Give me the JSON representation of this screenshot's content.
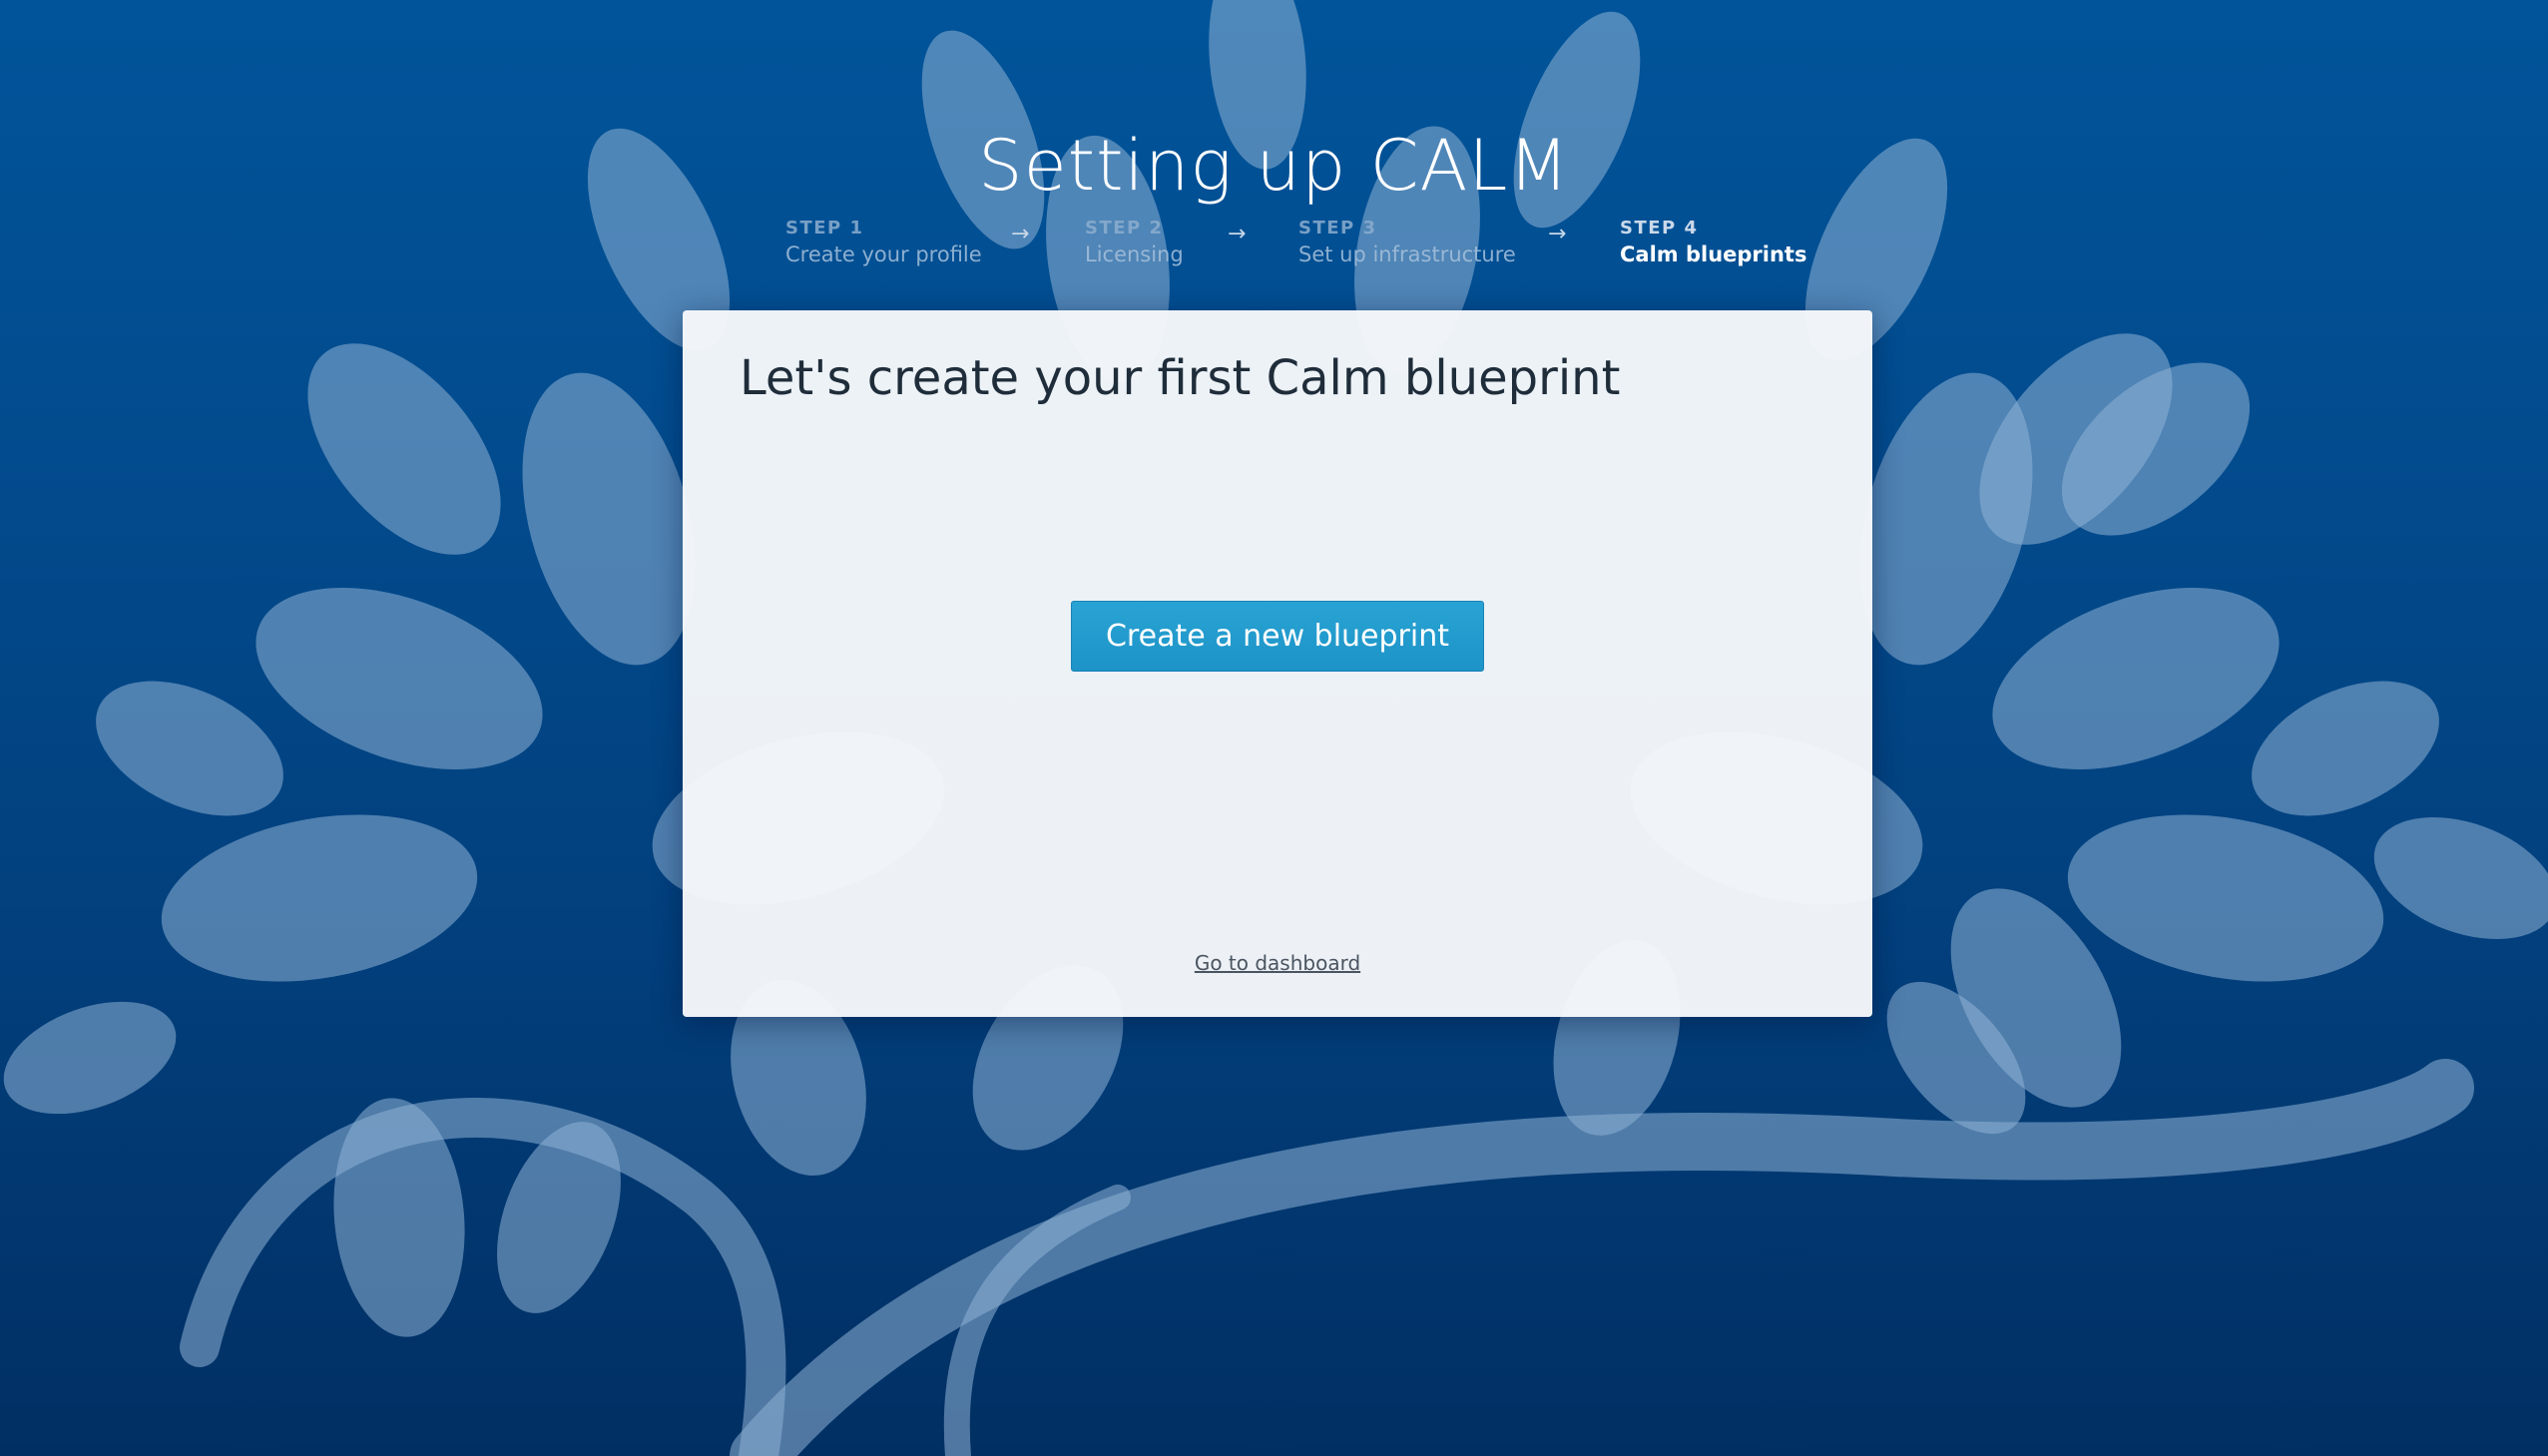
{
  "page": {
    "title": "Setting up CALM"
  },
  "stepper": {
    "steps": [
      {
        "number": "STEP 1",
        "label": "Create your profile",
        "state": "done"
      },
      {
        "number": "STEP 2",
        "label": "Licensing",
        "state": "done"
      },
      {
        "number": "STEP 3",
        "label": "Set up infrastructure",
        "state": "done"
      },
      {
        "number": "STEP 4",
        "label": "Calm blueprints",
        "state": "active"
      }
    ],
    "arrow_icon": "arrow-right-icon"
  },
  "card": {
    "title": "Let's create your first Calm blueprint",
    "primary_button_label": "Create a new blueprint",
    "dashboard_link_label": "Go to dashboard"
  },
  "colors": {
    "background_top": "#01549a",
    "background_bottom": "#012f63",
    "primary_button": "#1f97cb",
    "card_background": "#f5f7fa"
  }
}
